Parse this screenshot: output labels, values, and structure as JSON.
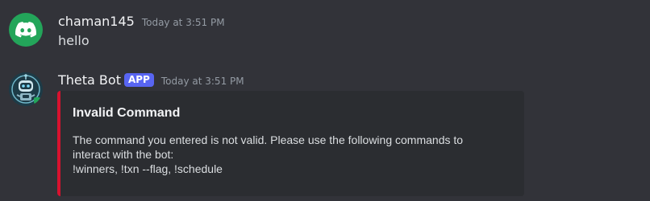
{
  "messages": [
    {
      "avatar_icon": "discord-logo-icon",
      "avatar_color": "#23a55a",
      "username": "chaman145",
      "timestamp": "Today at 3:51 PM",
      "content": "hello"
    },
    {
      "avatar_icon": "robot-icon",
      "username": "Theta Bot",
      "badge": "APP",
      "badge_color": "#5865f2",
      "timestamp": "Today at 3:51 PM",
      "embed": {
        "accent_color": "#d8122f",
        "title": "Invalid Command",
        "description": "The command you entered is not valid. Please use the following commands to\ninteract with the bot:\n!winners, !txn --flag, !schedule"
      }
    }
  ]
}
